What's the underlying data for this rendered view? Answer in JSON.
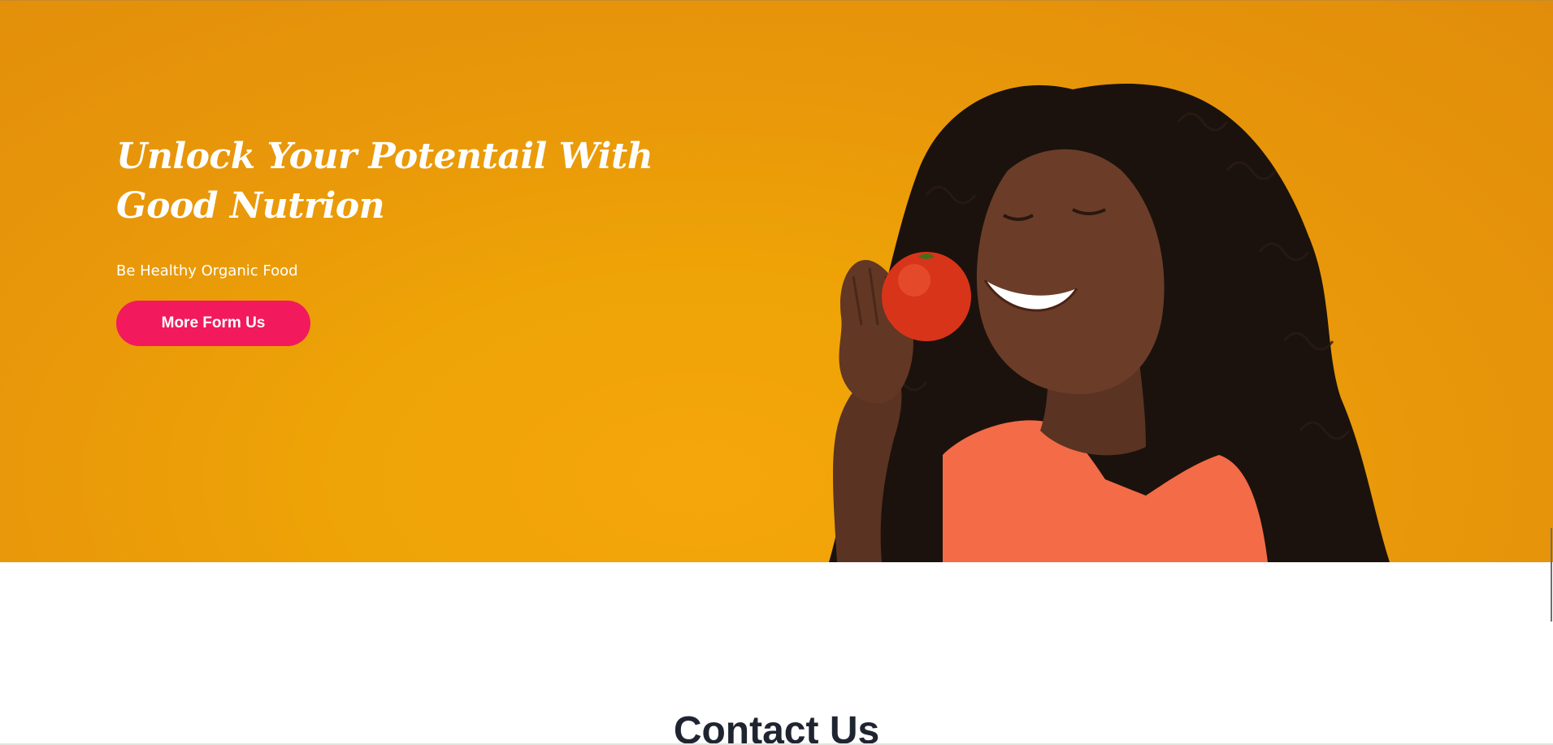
{
  "hero": {
    "title": "Unlock Your Potentail With Good Nutrion",
    "subtitle": "Be Healthy Organic Food",
    "button_label": "More Form Us",
    "image_icon": "woman-eating-tomato-photo"
  },
  "contact": {
    "title": "Contact Us"
  },
  "colors": {
    "hero_background": "#eea306",
    "button": "#f21a5c",
    "hero_text": "#ffffff",
    "heading_text": "#1f2530"
  }
}
